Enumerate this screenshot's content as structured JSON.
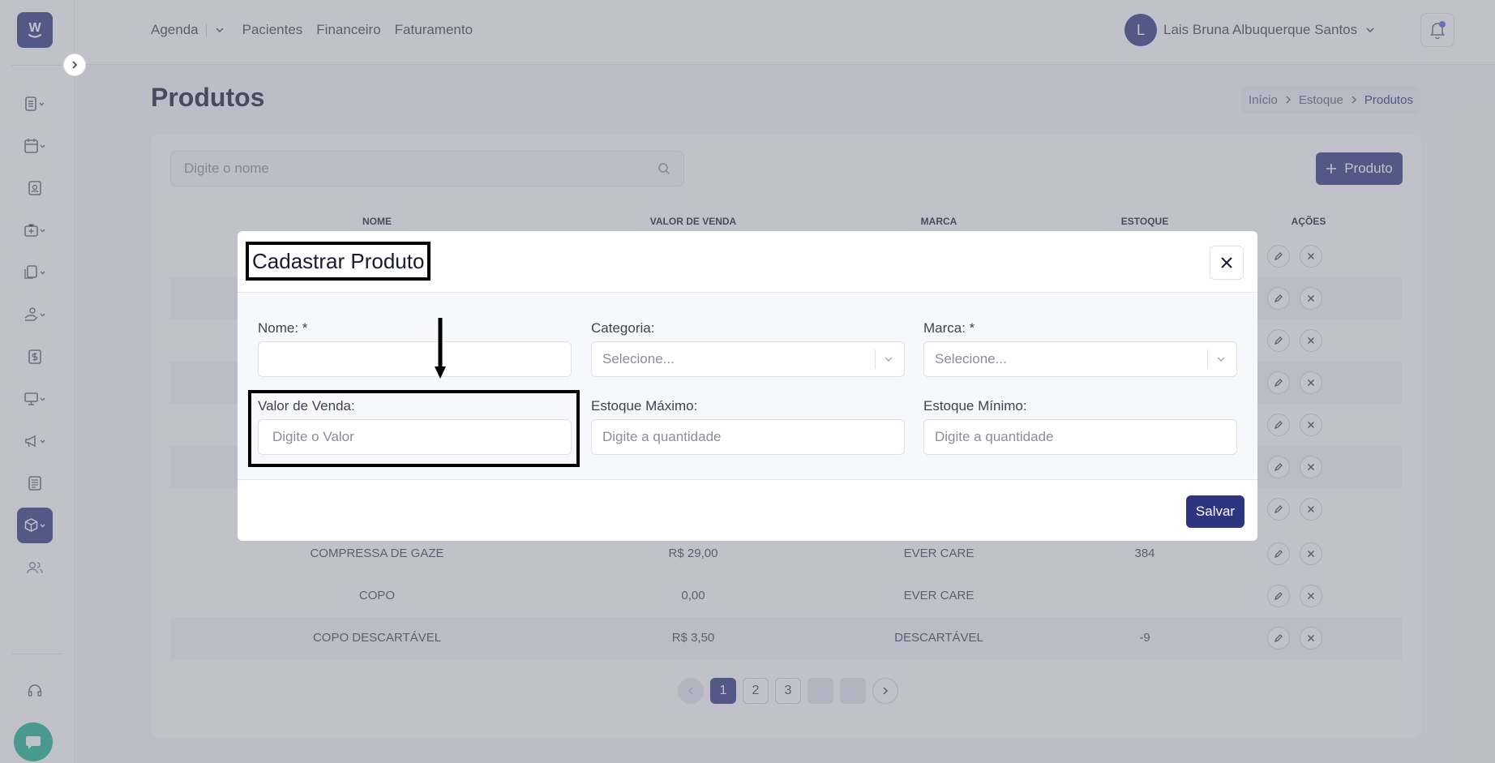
{
  "app": {
    "logo_letter": "W"
  },
  "topnav": {
    "items": [
      "Agenda",
      "Pacientes",
      "Financeiro",
      "Faturamento"
    ],
    "user_initial": "L",
    "user_name": "Lais Bruna Albuquerque Santos"
  },
  "page": {
    "title": "Produtos",
    "breadcrumb": [
      "Início",
      "Estoque",
      "Produtos"
    ]
  },
  "toolbar": {
    "search_placeholder": "Digite o nome",
    "add_label": "Produto"
  },
  "table": {
    "headers": [
      "NOME",
      "VALOR DE VENDA",
      "MARCA",
      "ESTOQUE",
      "AÇÕES"
    ],
    "visible_rows": [
      {
        "nome": "COMPRESSA DE GAZE",
        "valor": "R$ 29,00",
        "marca": "EVER CARE",
        "estoque": "384"
      },
      {
        "nome": "COPO",
        "valor": "0,00",
        "marca": "EVER CARE",
        "estoque": ""
      },
      {
        "nome": "COPO DESCARTÁVEL",
        "valor": "R$ 3,50",
        "marca": "DESCARTÁVEL",
        "estoque": "-9"
      }
    ]
  },
  "pagination": {
    "pages": [
      "1",
      "2",
      "3"
    ],
    "current": "1"
  },
  "modal": {
    "title": "Cadastrar Produto",
    "fields": {
      "nome": {
        "label": "Nome: *",
        "value": ""
      },
      "categoria": {
        "label": "Categoria:",
        "placeholder": "Selecione..."
      },
      "marca": {
        "label": "Marca: *",
        "placeholder": "Selecione..."
      },
      "valor_venda": {
        "label": "Valor de Venda:",
        "placeholder": "Digite o Valor"
      },
      "estoque_maximo": {
        "label": "Estoque Máximo:",
        "placeholder": "Digite a quantidade"
      },
      "estoque_minimo": {
        "label": "Estoque Mínimo:",
        "placeholder": "Digite a quantidade"
      }
    },
    "save_label": "Salvar"
  },
  "colors": {
    "primary": "#2d3580",
    "chat": "#1bb08c",
    "annotation": "#000000"
  }
}
